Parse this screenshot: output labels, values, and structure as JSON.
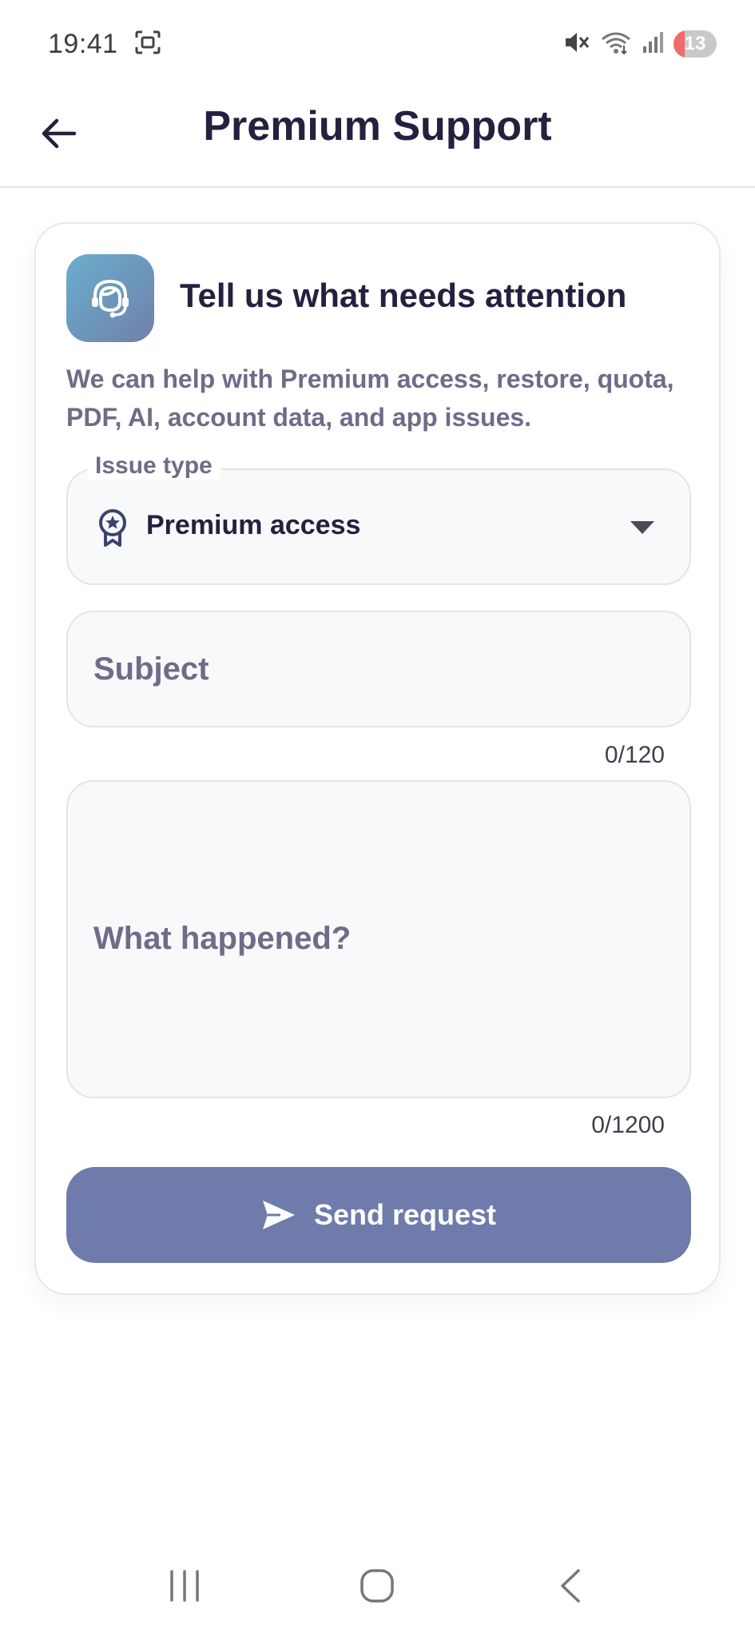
{
  "status_bar": {
    "time": "19:41",
    "battery": "13",
    "icons": [
      "screenshot-icon",
      "mute-icon",
      "wifi-icon",
      "signal-icon",
      "battery-icon"
    ]
  },
  "app_bar": {
    "title": "Premium Support",
    "back_icon": "arrow-left-icon"
  },
  "card": {
    "icon": "headset-support-icon",
    "title": "Tell us what needs attention",
    "description": "We can help with Premium access, restore, quota, PDF, AI, account data, and app issues."
  },
  "form": {
    "issue_type": {
      "label": "Issue type",
      "value": "Premium access",
      "icon": "award-badge-icon"
    },
    "subject": {
      "placeholder": "Subject",
      "value": "",
      "counter": "0/120"
    },
    "description": {
      "placeholder": "What happened?",
      "value": "",
      "counter": "0/1200"
    },
    "send_button": {
      "label": "Send request",
      "icon": "send-icon"
    }
  },
  "colors": {
    "accent": "#6e7bab",
    "title_text": "#24213f",
    "muted_text": "#6e6c88",
    "field_bg": "#f8f9fb",
    "icon_gradient_start": "#6aaecb",
    "icon_gradient_end": "#7080ad",
    "battery_low": "#f06b6b"
  },
  "nav_bar": {
    "items": [
      "recent-apps-icon",
      "home-icon",
      "back-icon"
    ]
  }
}
